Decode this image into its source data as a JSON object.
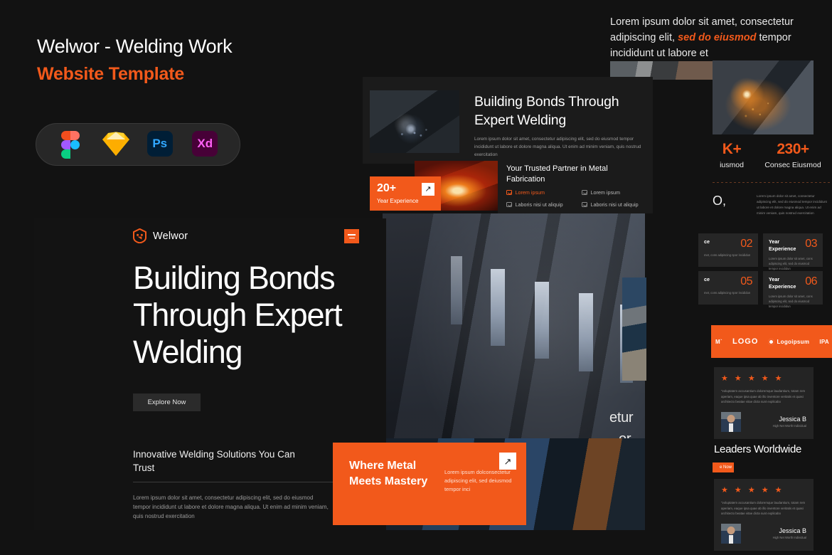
{
  "branding": {
    "title": "Welwor - Welding Work",
    "subtitle": "Website Template",
    "tools": [
      {
        "name": "figma-icon",
        "label": "Figma"
      },
      {
        "name": "sketch-icon",
        "label": "Sketch"
      },
      {
        "name": "photoshop-icon",
        "label": "Ps"
      },
      {
        "name": "adobe-xd-icon",
        "label": "Xd"
      }
    ]
  },
  "colors": {
    "accent": "#f2591b",
    "background": "#121212",
    "panel": "#1b1b1b",
    "card": "#262626",
    "text": "#ffffff",
    "muted": "#9a9a9a"
  },
  "top_right": {
    "lead_1": "Lorem ipsum dolor sit amet, consectetur adipiscing elit, ",
    "lead_em": "sed do eiusmod",
    "lead_2": " tempor incididunt ut labore et"
  },
  "card_top": {
    "heading": "Building Bonds Through Expert Welding",
    "body": "Lorem ipsum dolor sit amet, consectetur adipiscing elit, sed do eiusmod tempor incididunt ut labore et dolore magna aliqua. Ut enim ad minim veniam, quis nostrud exercitation"
  },
  "card_partner": {
    "heading": "Your Trusted Partner in Metal Fabrication",
    "features": [
      {
        "label": "Lorem ipsum",
        "highlight": true
      },
      {
        "label": "Lorem ipsum",
        "highlight": false
      },
      {
        "label": "Laboris nisi ut aliquip",
        "highlight": false
      },
      {
        "label": "Laboris nisi ut aliquip",
        "highlight": false
      }
    ]
  },
  "badge": {
    "number": "20+",
    "label": "Year Experience",
    "arrow": "↗"
  },
  "hero": {
    "logo_text": "Welwor",
    "headline": "Building Bonds Through Expert Welding",
    "cta": "Explore Now",
    "subhead": "Innovative Welding Solutions You Can Trust",
    "body": "Lorem ipsum dolor sit amet, consectetur adipiscing elit, sed do eiusmod tempor incididunt ut labore et dolore magna aliqua. Ut enim ad minim veniam, quis nostrud exercitation"
  },
  "mastery": {
    "heading": "Where Metal Meets Mastery",
    "body": "Lorem ipsum dolconsectetur adipiscing elit, sed deiusmod tempor inci",
    "arrow": "↗"
  },
  "ghost_text": {
    "line1": "etur",
    "line2": "or"
  },
  "right_column": {
    "stats": [
      {
        "number": "K+",
        "label": "iusmod"
      },
      {
        "number": "230+",
        "label": "Consec Eiusmod"
      }
    ],
    "stat_copy": "Lorem ipsum dolor sit amet, consectetur adipiscing elit, sed do eiusmod tempor incididunt ut labore et dolore magna aliqua. Ut enim ad minim veniam, quis nostrud exercitation",
    "ghost_char": "O,",
    "num_cards": [
      {
        "title": "ce",
        "number": "02",
        "desc": "met, cons adipiscing npor incididun"
      },
      {
        "title": "Year Experience",
        "number": "03",
        "desc": "Lorem ipsum dolor sit amet, cons adipiscing elit, sed do eiusmod tempor incididun"
      },
      {
        "title": "ce",
        "number": "05",
        "desc": "met, cons adipiscing npor incididun"
      },
      {
        "title": "Year Experience",
        "number": "06",
        "desc": "Lorem ipsum dolor sit amet, cons adipiscing elit, sed do eiusmod tempor incididun"
      }
    ],
    "logos": [
      {
        "label": "M`"
      },
      {
        "label": "LOGO"
      },
      {
        "label": "Logoipsum"
      },
      {
        "label": "IPA"
      }
    ],
    "testimonials": [
      {
        "stars": "★ ★ ★ ★ ★",
        "quote": "\"voluptatem accusantium doloremque laudantium, totam rem aperiam, eaque ipsa quae ab illo inventore veritatis et quasi architecto beatae vitae dicta sunt explicabo",
        "name": "Jessica B",
        "role": "High Net Worth Individual"
      },
      {
        "stars": "★ ★ ★ ★ ★",
        "quote": "\"voluptatem accusantium doloremque laudantium, totam rem aperiam, eaque ipsa quae ab illo inventore veritatis et quasi architecto beatae vitae dicta sunt explicabo",
        "name": "Jessica B",
        "role": "High Net Worth Individual"
      }
    ],
    "leaders_heading": "Leaders Worldwide",
    "leaders_button": "e Now"
  }
}
